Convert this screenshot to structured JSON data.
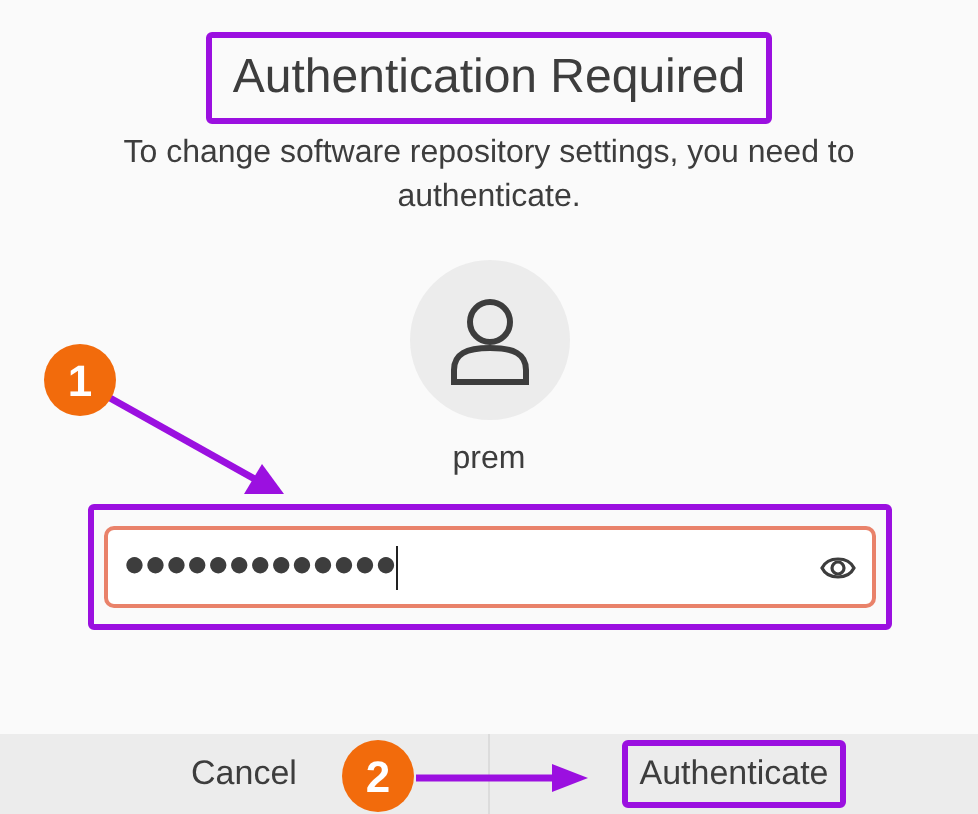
{
  "dialog": {
    "title": {
      "text": "Authentication Required",
      "highlighted": true
    },
    "message": "To change software repository settings, you need to authenticate.",
    "user": {
      "name": "prem"
    },
    "password_field": {
      "value": "●●●●●●●●●●●●●",
      "focused": true,
      "highlighted": true
    },
    "buttons": [
      {
        "label": "Cancel",
        "highlighted": false
      },
      {
        "label": "Authenticate",
        "highlighted": true
      }
    ]
  },
  "annotations": [
    {
      "kind": "step",
      "label": "1"
    },
    {
      "kind": "step",
      "label": "2"
    }
  ]
}
